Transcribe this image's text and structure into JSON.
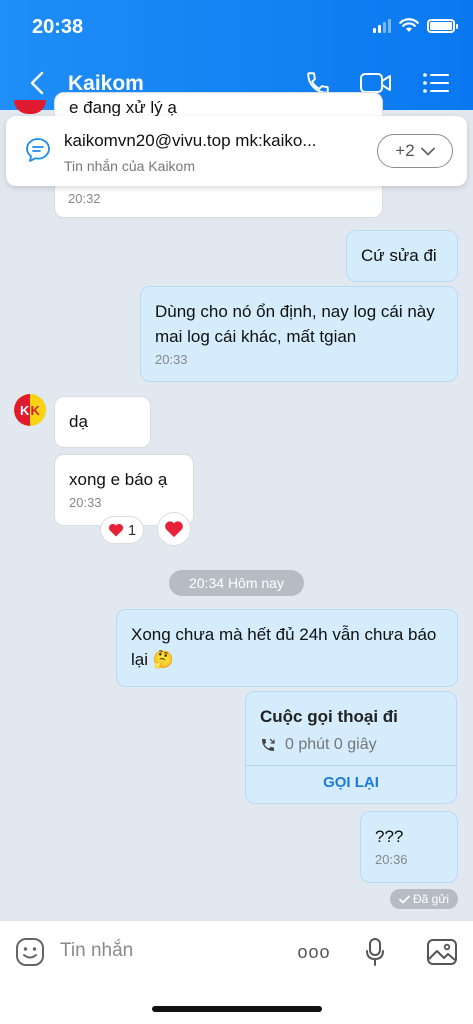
{
  "status": {
    "time": "20:38"
  },
  "header": {
    "title": "Kaikom"
  },
  "pinned": {
    "text": "kaikomvn20@vivu.top mk:kaiko...",
    "subtitle": "Tin nhắn của Kaikom",
    "more_label": "+2"
  },
  "messages": {
    "partial_text": "e đang xử lý ạ",
    "partial_time": "20:32",
    "out_1": "Cứ sửa đi",
    "out_2_text": "Dùng cho nó ổn định, nay log cái này mai log cái khác, mất tgian",
    "out_2_time": "20:33",
    "in_1": "dạ",
    "in_2_text": "xong e báo ạ",
    "in_2_time": "20:33",
    "reaction_count": "1",
    "date_separator": "20:34 Hôm nay",
    "out_3_text": "Xong chưa mà hết đủ 24h vẫn chưa báo lại",
    "out_3_emoji": "🤔",
    "out_4_text": "???",
    "out_4_time": "20:36",
    "sent_status": "Đã gửi"
  },
  "call_card": {
    "title": "Cuộc gọi thoại đi",
    "duration": "0 phút 0 giây",
    "action": "GỌI LẠI"
  },
  "composer": {
    "placeholder": "Tin nhắn",
    "more_label": "ooo"
  },
  "colors": {
    "header": "#0a78f0",
    "outgoing_bubble": "#d4ecfc",
    "link": "#1a7ae0"
  },
  "icons": [
    "back-icon",
    "phone-icon",
    "video-call-icon",
    "menu-list-icon",
    "pinned-message-icon",
    "chevron-down-icon",
    "heart-icon",
    "phone-call-icon",
    "check-icon",
    "sticker-icon",
    "more-icon",
    "mic-icon",
    "image-icon"
  ]
}
